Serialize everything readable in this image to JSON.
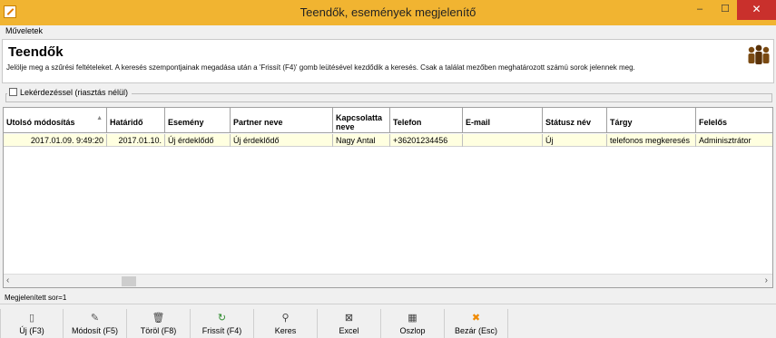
{
  "window": {
    "title": "Teendők, események megjelenítő",
    "minimize": "–",
    "maximize": "☐",
    "close": "✕",
    "icon": "app-logo-icon"
  },
  "menu": {
    "items": [
      "Műveletek"
    ]
  },
  "header": {
    "title": "Teendők",
    "description": "Jelölje meg a szűrési feltételeket. A keresés szempontjainak megadása után a 'Frissít (F4)' gomb leütésével kezdődik a keresés. Csak a találat mezőben meghatározott számú sorok jelennek meg.",
    "icon": "people-icon"
  },
  "filter": {
    "checkbox_label": "Lekérdezéssel (riasztás nélül)",
    "checked": false
  },
  "grid": {
    "columns": [
      "Utolsó módosítás",
      "Határidő",
      "Esemény",
      "Partner neve",
      "Kapcsolatta neve",
      "Telefon",
      "E-mail",
      "Státusz név",
      "Tárgy",
      "Felelős"
    ],
    "sort_indicator": "▲",
    "rows": [
      [
        "2017.01.09. 9:49:20",
        "2017.01.10.",
        "Új érdeklődő",
        "Új érdeklődő",
        "Nagy Antal",
        "+36201234456",
        "",
        "Új",
        "telefonos megkeresés",
        "Adminisztrátor"
      ]
    ],
    "scroll_left": "‹",
    "scroll_right": "›"
  },
  "status": {
    "text": "Megjelenített sor=1"
  },
  "toolbar": {
    "buttons": [
      {
        "label": "Új (F3)",
        "icon": "new-document-icon",
        "glyph": "▯",
        "color": "#555555"
      },
      {
        "label": "Módosít (F5)",
        "icon": "edit-icon",
        "glyph": "✎",
        "color": "#555555"
      },
      {
        "label": "Töröl (F8)",
        "icon": "trash-icon",
        "glyph": "🗑",
        "color": "#444444"
      },
      {
        "label": "Frissít (F4)",
        "icon": "refresh-icon",
        "glyph": "↻",
        "color": "#2e8b2e"
      },
      {
        "label": "Keres",
        "icon": "search-icon",
        "glyph": "⚲",
        "color": "#444444"
      },
      {
        "label": "Excel",
        "icon": "excel-icon",
        "glyph": "⊠",
        "color": "#333333"
      },
      {
        "label": "Oszlop",
        "icon": "columns-icon",
        "glyph": "▦",
        "color": "#444444"
      },
      {
        "label": "Bezár (Esc)",
        "icon": "close-icon",
        "glyph": "✖",
        "color": "#f08a00"
      }
    ]
  },
  "colors": {
    "titlebar": "#f1b431",
    "selected_row": "#ffffe0",
    "close_button": "#c9302c"
  }
}
